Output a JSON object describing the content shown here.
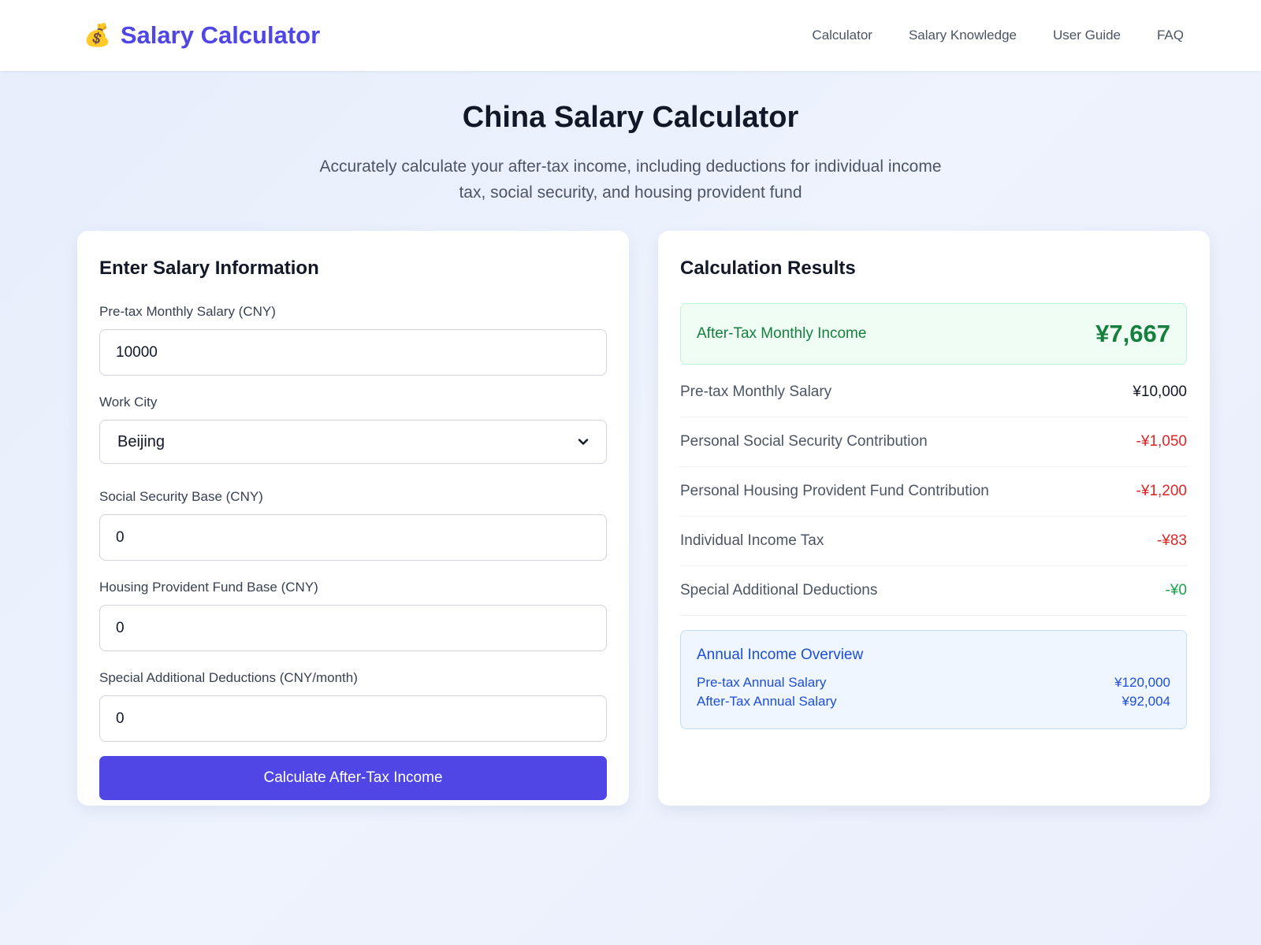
{
  "header": {
    "brand_icon": "money-bag-icon",
    "brand_glyph": "💰",
    "brand_title": "Salary Calculator",
    "nav": [
      "Calculator",
      "Salary Knowledge",
      "User Guide",
      "FAQ"
    ]
  },
  "hero": {
    "title": "China Salary Calculator",
    "subtitle": "Accurately calculate your after-tax income, including deductions for individual income tax, social security, and housing provident fund"
  },
  "form": {
    "title": "Enter Salary Information",
    "salary_label": "Pre-tax Monthly Salary (CNY)",
    "salary_value": "10000",
    "city_label": "Work City",
    "city_value": "Beijing",
    "ss_base_label": "Social Security Base (CNY)",
    "ss_base_value": "0",
    "hpf_base_label": "Housing Provident Fund Base (CNY)",
    "hpf_base_value": "0",
    "special_label": "Special Additional Deductions (CNY/month)",
    "special_value": "0",
    "button_label": "Calculate After-Tax Income"
  },
  "results": {
    "title": "Calculation Results",
    "highlight_label": "After-Tax Monthly Income",
    "highlight_value": "¥7,667",
    "rows": [
      {
        "label": "Pre-tax Monthly Salary",
        "value": "¥10,000"
      },
      {
        "label": "Personal Social Security Contribution",
        "value": "-¥1,050"
      },
      {
        "label": "Personal Housing Provident Fund Contribution",
        "value": "-¥1,200"
      },
      {
        "label": "Individual Income Tax",
        "value": "-¥83"
      },
      {
        "label": "Special Additional Deductions",
        "value": "-¥0"
      }
    ],
    "annual": {
      "title": "Annual Income Overview",
      "pretax_label": "Pre-tax Annual Salary",
      "pretax_value": "¥120,000",
      "aftertax_label": "After-Tax Annual Salary",
      "aftertax_value": "¥92,004"
    }
  },
  "colors": {
    "brand": "#4f46e5",
    "positive": "#16a34a",
    "negative": "#dc2626",
    "info": "#1d4ed8"
  }
}
